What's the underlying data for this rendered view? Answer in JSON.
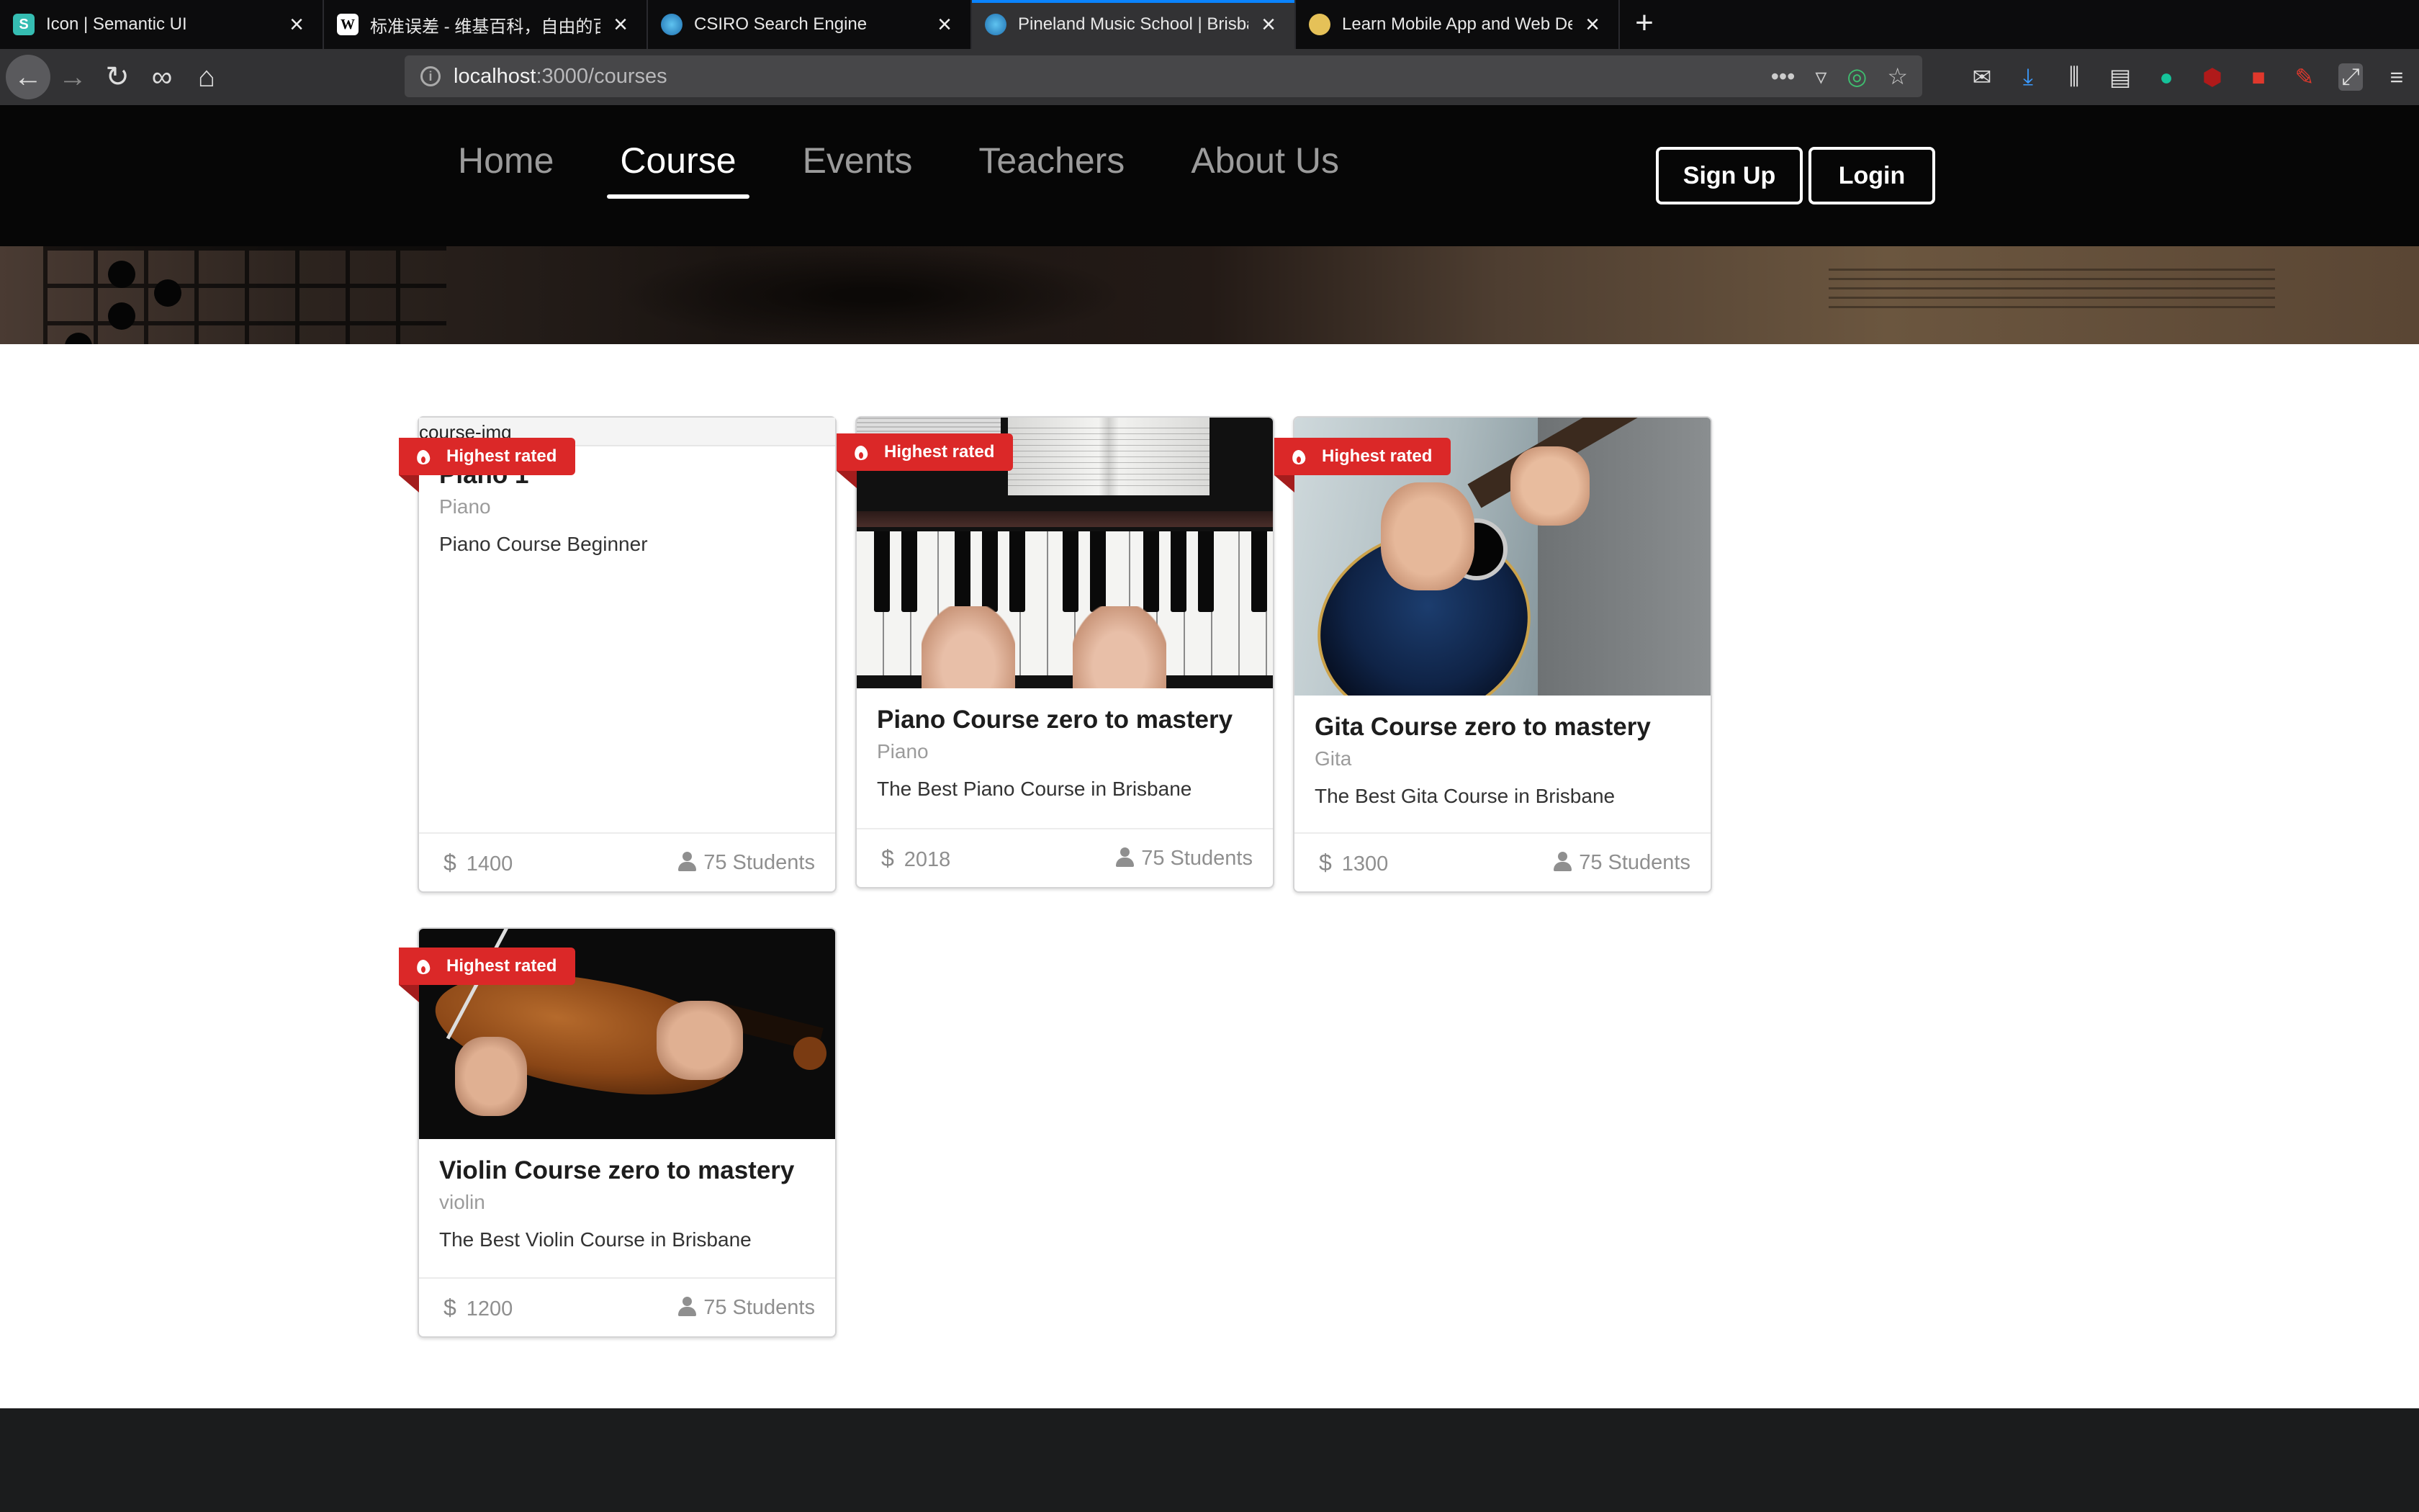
{
  "browser": {
    "tabs": [
      {
        "title": "Icon | Semantic UI",
        "favicon": "S",
        "favicon_bg": "#35bdb2",
        "active": false
      },
      {
        "title": "标准误差 - 维基百科，自由的百科",
        "favicon": "W",
        "favicon_bg": "#ffffff",
        "active": false
      },
      {
        "title": "CSIRO Search Engine",
        "favicon": "csiro-icon",
        "favicon_bg": "#1e88c8",
        "active": false
      },
      {
        "title": "Pineland Music School | Brisbane",
        "favicon": "globe-icon",
        "favicon_bg": "#1e88c8",
        "active": true
      },
      {
        "title": "Learn Mobile App and Web Dev",
        "favicon": "coin-icon",
        "favicon_bg": "#e5c158",
        "active": false
      }
    ],
    "url_host": "localhost",
    "url_path": ":3000/courses"
  },
  "site": {
    "menu": [
      "Home",
      "Course",
      "Events",
      "Teachers",
      "About Us"
    ],
    "active_menu": "Course",
    "signup_label": "Sign Up",
    "login_label": "Login"
  },
  "ribbon_label": "Highest rated",
  "courses": [
    {
      "image_alt": "course-img",
      "title": "Piano 1",
      "category": "Piano",
      "description": "Piano Course Beginner",
      "price": "1400",
      "students": "75 Students"
    },
    {
      "image_alt": "",
      "title": "Piano Course zero to mastery",
      "category": "Piano",
      "description": "The Best Piano Course in Brisbane",
      "price": "2018",
      "students": "75 Students"
    },
    {
      "image_alt": "",
      "title": "Gita Course zero to mastery",
      "category": "Gita",
      "description": "The Best Gita Course in Brisbane",
      "price": "1300",
      "students": "75 Students"
    },
    {
      "image_alt": "",
      "title": "Violin Course zero to mastery",
      "category": "violin",
      "description": "The Best Violin Course in Brisbane",
      "price": "1200",
      "students": "75 Students"
    }
  ],
  "colors": {
    "ribbon": "#db2828",
    "header_bg": "#060606",
    "footer_bg": "#1b1c1d",
    "tab_accent": "#0a84ff"
  }
}
